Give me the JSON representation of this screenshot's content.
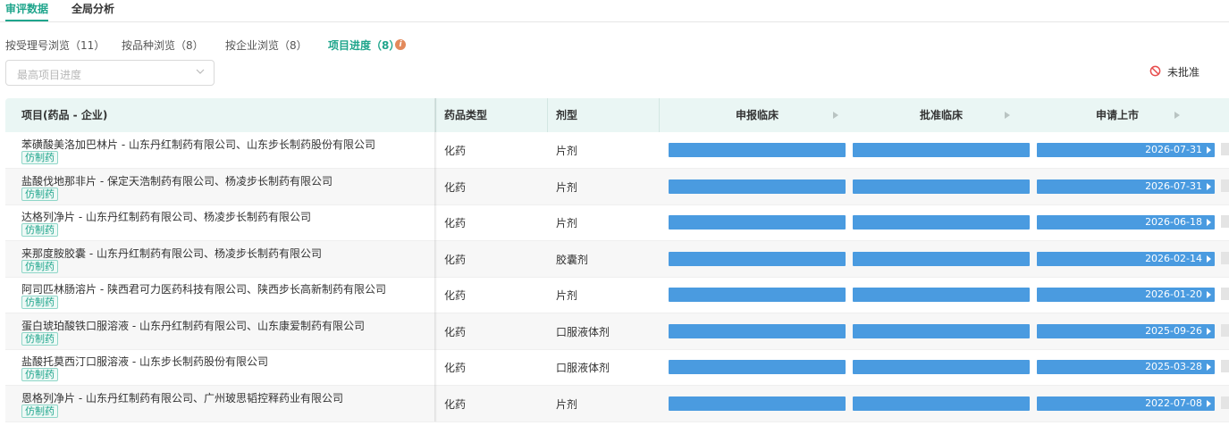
{
  "top_tabs": [
    {
      "label": "审评数据",
      "active": true
    },
    {
      "label": "全局分析",
      "active": false
    }
  ],
  "sub_tabs": [
    {
      "label": "按受理号浏览（11）"
    },
    {
      "label": "按品种浏览（8）"
    },
    {
      "label": "按企业浏览（8）"
    },
    {
      "label": "项目进度（8）",
      "active": true
    }
  ],
  "filter": {
    "placeholder": "最高项目进度"
  },
  "legend": {
    "label": "未批准",
    "icon": "ban-icon",
    "color": "#e74c4c"
  },
  "table": {
    "headers": {
      "project": "项目(药品 - 企业)",
      "drug_type": "药品类型",
      "dosage_form": "剂型"
    },
    "stages": [
      "申报临床",
      "批准临床",
      "申请上市"
    ],
    "bar_color": "#4a9be0",
    "rows": [
      {
        "name": "苯磺酸美洛加巴林片 - 山东丹红制药有限公司、山东步长制药股份有限公司",
        "tag": "仿制药",
        "drug_type": "化药",
        "dosage_form": "片剂",
        "date": "2026-07-31"
      },
      {
        "name": "盐酸伐地那非片 - 保定天浩制药有限公司、杨凌步长制药有限公司",
        "tag": "仿制药",
        "drug_type": "化药",
        "dosage_form": "片剂",
        "date": "2026-07-31"
      },
      {
        "name": "达格列净片 - 山东丹红制药有限公司、杨凌步长制药有限公司",
        "tag": "仿制药",
        "drug_type": "化药",
        "dosage_form": "片剂",
        "date": "2026-06-18"
      },
      {
        "name": "来那度胺胶囊 - 山东丹红制药有限公司、杨凌步长制药有限公司",
        "tag": "仿制药",
        "drug_type": "化药",
        "dosage_form": "胶囊剂",
        "date": "2026-02-14"
      },
      {
        "name": "阿司匹林肠溶片 - 陕西君可力医药科技有限公司、陕西步长高新制药有限公司",
        "tag": "仿制药",
        "drug_type": "化药",
        "dosage_form": "片剂",
        "date": "2026-01-20"
      },
      {
        "name": "蛋白琥珀酸铁口服溶液 - 山东丹红制药有限公司、山东康爱制药有限公司",
        "tag": "仿制药",
        "drug_type": "化药",
        "dosage_form": "口服液体剂",
        "date": "2025-09-26"
      },
      {
        "name": "盐酸托莫西汀口服溶液 - 山东步长制药股份有限公司",
        "tag": "仿制药",
        "drug_type": "化药",
        "dosage_form": "口服液体剂",
        "date": "2025-03-28"
      },
      {
        "name": "恩格列净片 - 山东丹红制药有限公司、广州玻思韬控释药业有限公司",
        "tag": "仿制药",
        "drug_type": "化药",
        "dosage_form": "片剂",
        "date": "2022-07-08"
      }
    ]
  }
}
